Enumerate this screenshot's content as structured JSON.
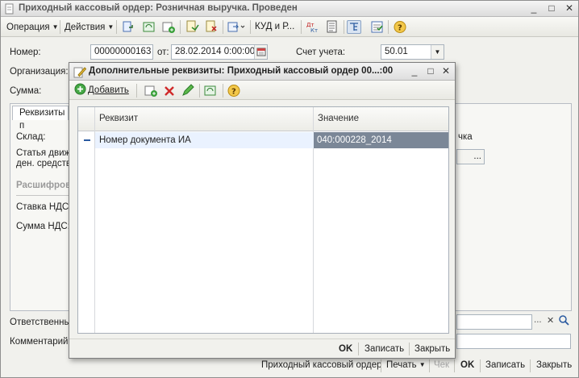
{
  "window": {
    "title": "Приходный кассовый ордер: Розничная выручка. Проведен",
    "minimize": "_",
    "maximize": "□",
    "close": "✕"
  },
  "toolbar": {
    "operation": "Операция",
    "actions": "Действия",
    "kud": "КУД и Р...",
    "dt_kt": "Дт Кт"
  },
  "form": {
    "number_label": "Номер:",
    "number_value": "00000000163",
    "date_label": "от:",
    "date_value": "28.02.2014  0:00:00",
    "account_label": "Счет учета:",
    "account_value": "50.01",
    "org_label": "Организация:",
    "sum_label": "Сумма:",
    "tab_label": "Реквизиты п",
    "warehouse_label": "Склад:",
    "cashflow_label_1": "Статья движ",
    "cashflow_label_2": "ден. средств",
    "section_label": "Расшифров",
    "vat_rate_label": "Ставка НДС:",
    "vat_sum_label": "Сумма НДС:",
    "right_partial": "чка",
    "ellipsis": "...",
    "responsible_label": "Ответственны",
    "comment_label": "Комментарий:"
  },
  "bottom": {
    "doc_name": "Приходный кассовый ордер",
    "print": "Печать",
    "check": "Чек",
    "ok": "OK",
    "save": "Записать",
    "close": "Закрыть"
  },
  "dialog": {
    "title": "Дополнительные реквизиты: Приходный кассовый ордер 00...:00",
    "minimize": "_",
    "maximize": "□",
    "close": "✕",
    "add_label": "Добавить",
    "columns": [
      "Реквизит",
      "Значение"
    ],
    "rows": [
      {
        "attribute": "Номер документа ИА",
        "value": "040:000228_2014"
      }
    ],
    "ok": "OK",
    "save": "Записать",
    "close_btn": "Закрыть"
  },
  "colors": {
    "selected_row": "#eaf2ff",
    "selected_cell": "#7b8797",
    "window_bg": "#f1f1ed"
  }
}
